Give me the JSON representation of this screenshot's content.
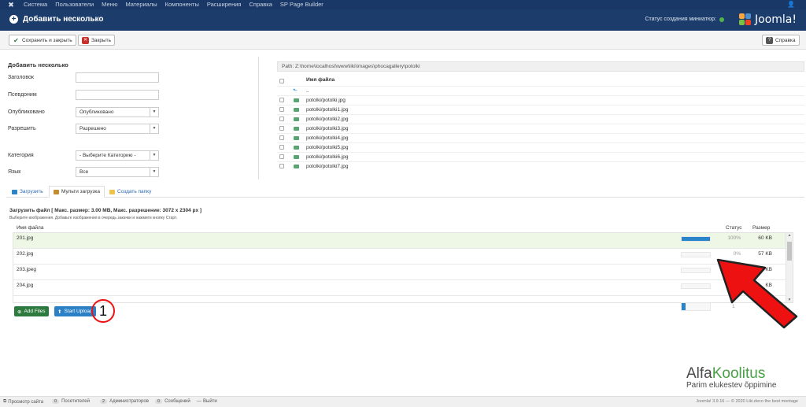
{
  "topnav": {
    "items": [
      "Система",
      "Пользователи",
      "Меню",
      "Материалы",
      "Компоненты",
      "Расширения",
      "Справка",
      "SP Page Builder"
    ]
  },
  "header": {
    "title": "Добавить несколько",
    "thumbnail_status": "Статус создания миниатюр:",
    "brand": "Joomla!"
  },
  "toolbar": {
    "save_close": "Сохранить и закрыть",
    "close": "Закрыть",
    "help": "Справка"
  },
  "form": {
    "title": "Добавить несколько",
    "fields": {
      "title_label": "Заголовок",
      "alias_label": "Псевдоним",
      "published_label": "Опубликовано",
      "published_value": "Опубликовано",
      "approve_label": "Разрешить",
      "approve_value": "Разрешено",
      "category_label": "Категория",
      "category_value": "- Выберите Категорию -",
      "language_label": "Язык",
      "language_value": "Все"
    }
  },
  "browser": {
    "path": "Path: Z:\\home\\localhost\\www\\liki\\images\\phocagallery\\potolki",
    "column_name": "Имя файла",
    "up_label": "..",
    "files": [
      "potolki/potolki.jpg",
      "potolki/potolki1.jpg",
      "potolki/potolki2.jpg",
      "potolki/potolki3.jpg",
      "potolki/potolki4.jpg",
      "potolki/potolki5.jpg",
      "potolki/potolki6.jpg",
      "potolki/potolki7.jpg"
    ]
  },
  "tabs": {
    "upload": "Загрузить",
    "multi": "Мульти загрузка",
    "folder": "Создать папку"
  },
  "uploader": {
    "title": "Загрузить файл [ Макс. размер: 3.00 MB, Макс. разрешение: 3072 x 2304 px ]",
    "hint": "Выберите изображения. Добавьте изображения в очередь закачки и нажмите кнопку Старт.",
    "col_name": "Имя файла",
    "col_status": "Статус",
    "col_size": "Размер",
    "rows": [
      {
        "name": "201.jpg",
        "progress": 100,
        "status": "100%",
        "size": "60 KB"
      },
      {
        "name": "202.jpg",
        "progress": 0,
        "status": "0%",
        "size": "57 KB"
      },
      {
        "name": "203.jpeg",
        "progress": 0,
        "status": "0%",
        "size": "16 KB"
      },
      {
        "name": "204.jpg",
        "progress": 0,
        "status": "",
        "size": "KB"
      }
    ],
    "add_files": "Add Files",
    "start_upload": "Start Upload",
    "total_progress": 15,
    "total_status": "1"
  },
  "annotation": {
    "step": "1",
    "arrow_color": "#e11"
  },
  "watermark": {
    "alfa": "Alfa",
    "koolitus": "Koolitus",
    "slogan": "Parim elukestev õppimine"
  },
  "statusbar": {
    "view_site": "Просмотр сайта",
    "visitors_count": "0",
    "visitors": "Посетителей",
    "admins_count": "2",
    "admins": "Администраторов",
    "messages_count": "0",
    "messages": "Сообщений",
    "logout": "Выйти",
    "copyright": "Joomla! 3.9.16  —  © 2020 Liki.deco the best montage"
  },
  "colors": {
    "nav_bg": "#1a3867",
    "header_bg": "#1c3d6c",
    "accent_blue": "#2b80c6",
    "accent_green": "#2d7a3e",
    "row_success_bg": "#eef6e6"
  }
}
